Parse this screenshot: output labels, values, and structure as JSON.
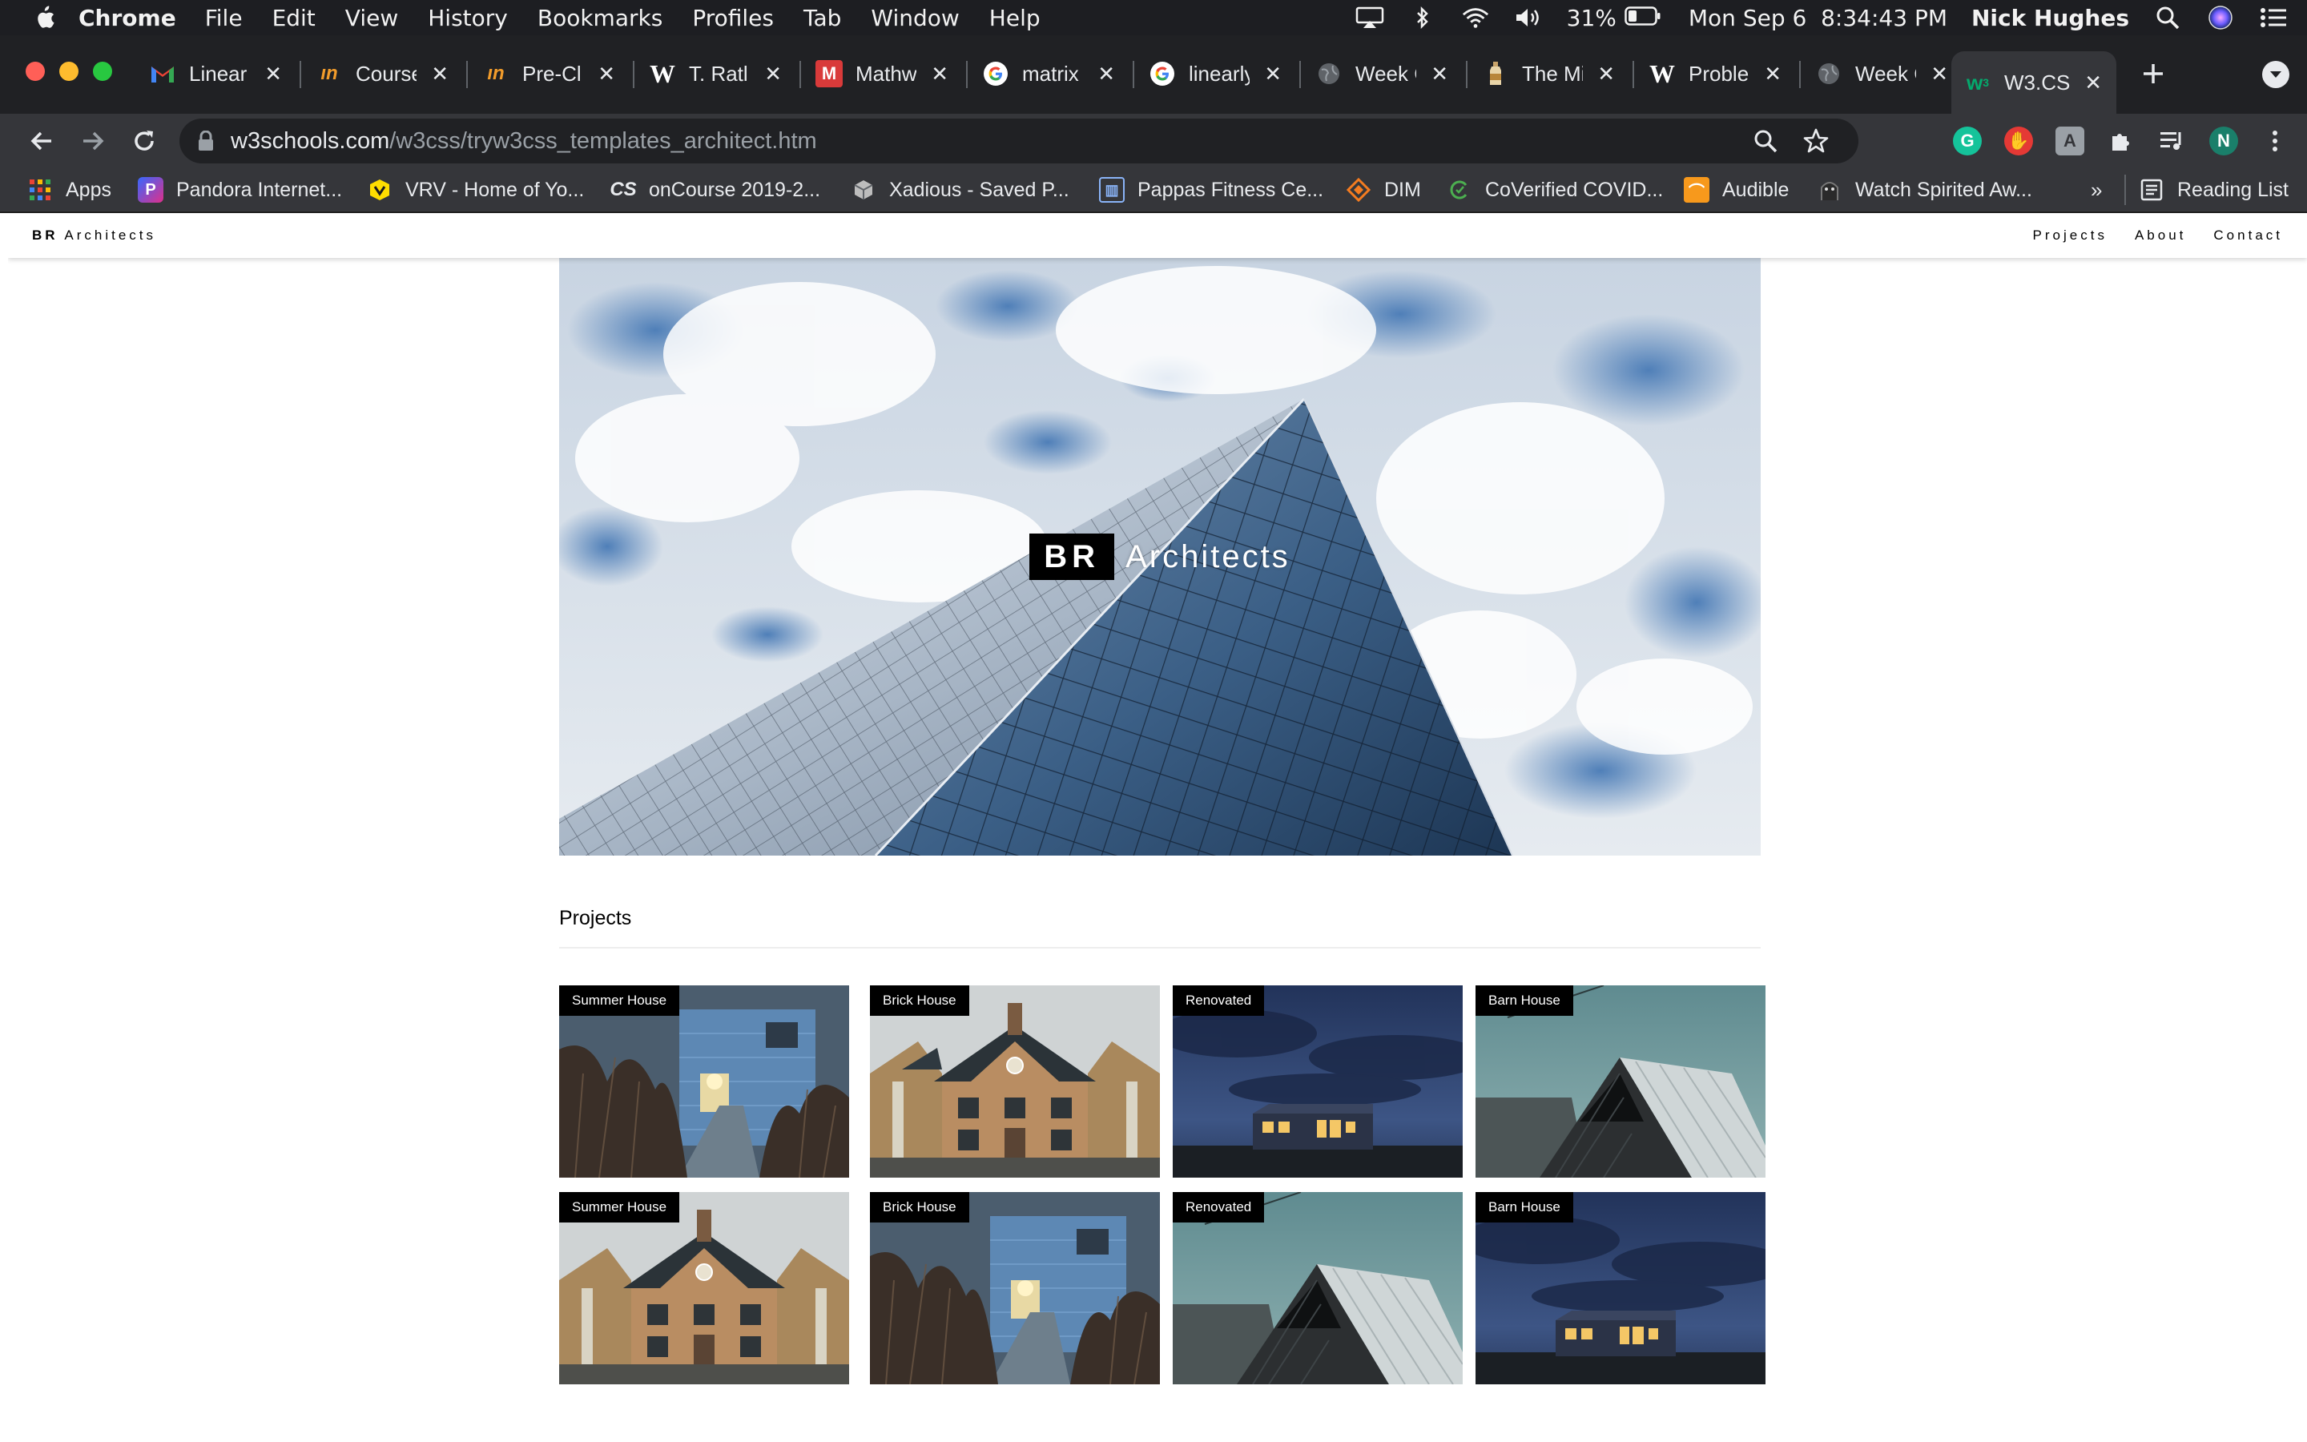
{
  "menubar": {
    "app_name": "Chrome",
    "menus": [
      "File",
      "Edit",
      "View",
      "History",
      "Bookmarks",
      "Profiles",
      "Tab",
      "Window",
      "Help"
    ],
    "battery": "31%",
    "datetime": "Mon Sep 6  8:34:43 PM",
    "user": "Nick Hughes"
  },
  "tabs": [
    {
      "title": "Linear",
      "favicon": "gmail-icon"
    },
    {
      "title": "Course",
      "favicon": "mathnet-icon"
    },
    {
      "title": "Pre-Cl",
      "favicon": "mathnet-icon"
    },
    {
      "title": "T. Ratl",
      "favicon": "wikipedia-icon"
    },
    {
      "title": "Mathw",
      "favicon": "mathworks-icon"
    },
    {
      "title": "matrix",
      "favicon": "google-icon"
    },
    {
      "title": "linearly",
      "favicon": "google-icon"
    },
    {
      "title": "Week C",
      "favicon": "globe-icon"
    },
    {
      "title": "The Mi",
      "favicon": "bottle-icon"
    },
    {
      "title": "Probler",
      "favicon": "wikipedia-icon"
    },
    {
      "title": "Week C",
      "favicon": "globe-icon"
    },
    {
      "title": "W3.CS",
      "favicon": "w3schools-icon",
      "active": true
    }
  ],
  "omnibox": {
    "domain": "w3schools.com",
    "path": "/w3css/tryw3css_templates_architect.htm"
  },
  "extensions": {
    "profile_initial": "N"
  },
  "bookmarks": {
    "items": [
      "Apps",
      "Pandora Internet...",
      "VRV - Home of Yo...",
      "onCourse 2019-2...",
      "Xadious - Saved P...",
      "Pappas Fitness Ce...",
      "DIM",
      "CoVerified COVID...",
      "Audible",
      "Watch Spirited Aw..."
    ],
    "overflow": "»",
    "reading_list": "Reading List"
  },
  "site": {
    "brand_bold": "BR",
    "brand_rest": "Architects",
    "nav_links": [
      "Projects",
      "About",
      "Contact"
    ],
    "hero_bold": "BR",
    "hero_rest": "Architects",
    "projects_heading": "Projects",
    "projects": [
      {
        "label": "Summer House",
        "scene": "blue-house"
      },
      {
        "label": "Brick House",
        "scene": "brick-house"
      },
      {
        "label": "Renovated",
        "scene": "night-house"
      },
      {
        "label": "Barn House",
        "scene": "barn-house"
      },
      {
        "label": "Summer House",
        "scene": "brick-house"
      },
      {
        "label": "Brick House",
        "scene": "blue-house"
      },
      {
        "label": "Renovated",
        "scene": "barn-house"
      },
      {
        "label": "Barn House",
        "scene": "night-house"
      }
    ]
  },
  "colors": {
    "menubar_bg": "#1d1e22",
    "tabstrip_bg": "#202124",
    "toolbar_bg": "#35363a",
    "traffic_red": "#ff5f57",
    "traffic_yellow": "#febc2e",
    "traffic_green": "#28c840"
  }
}
